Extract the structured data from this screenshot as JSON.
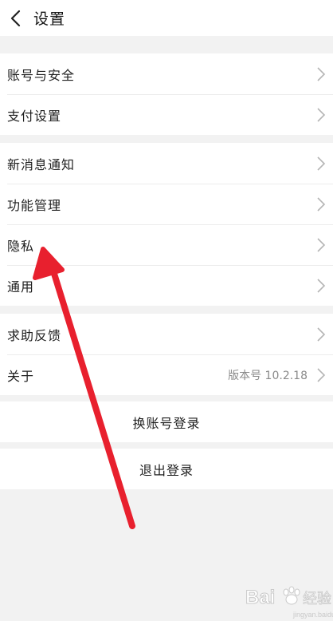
{
  "header": {
    "title": "设置",
    "back_icon": "chevron-left-icon"
  },
  "group1": {
    "items": [
      {
        "label": "账号与安全"
      },
      {
        "label": "支付设置"
      }
    ]
  },
  "group2": {
    "items": [
      {
        "label": "新消息通知"
      },
      {
        "label": "功能管理"
      },
      {
        "label": "隐私"
      },
      {
        "label": "通用"
      }
    ]
  },
  "group3": {
    "items": [
      {
        "label": "求助反馈"
      },
      {
        "label": "关于",
        "value": "版本号 10.2.18"
      }
    ]
  },
  "actions": {
    "switch_account": "换账号登录",
    "logout": "退出登录"
  },
  "annotation": {
    "arrow_color": "#e8202e"
  },
  "watermark": {
    "brand": "Bai",
    "brand2": "经验",
    "url": "jingyan.baidu.com"
  },
  "colors": {
    "background": "#f2f2f2",
    "row": "#ffffff",
    "separator": "#ececec",
    "chevron": "#b5b5b5"
  }
}
